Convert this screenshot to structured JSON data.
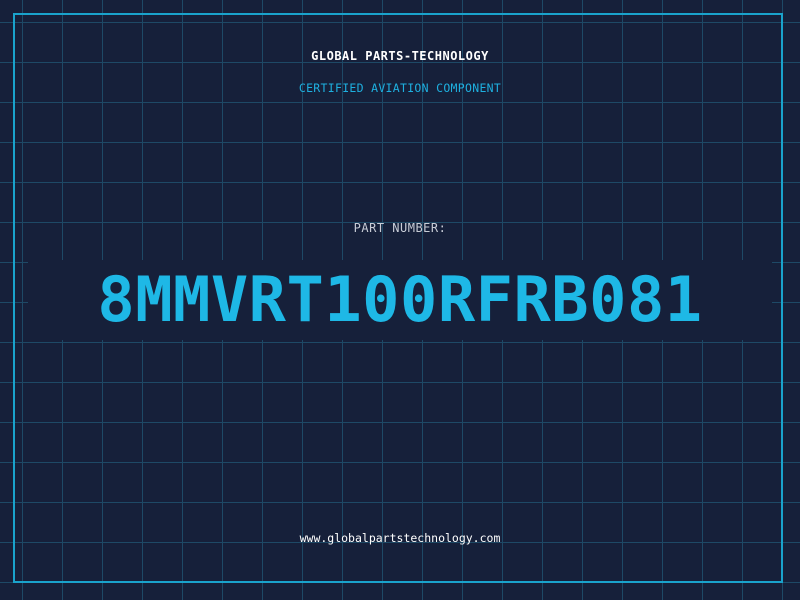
{
  "header": {
    "company_name": "GLOBAL PARTS-TECHNOLOGY",
    "tagline": "CERTIFIED AVIATION COMPONENT"
  },
  "part": {
    "label": "PART NUMBER:",
    "number": "8MMVRT100RFRB081"
  },
  "footer": {
    "website": "www.globalpartstechnology.com"
  },
  "colors": {
    "background": "#16203a",
    "grid": "#1e4966",
    "accent": "#1eb8e6",
    "frame": "#1aa3cc"
  }
}
